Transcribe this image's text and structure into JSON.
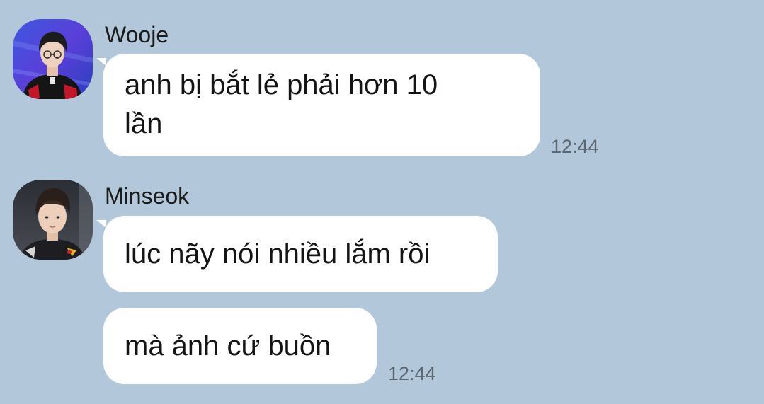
{
  "background_color": "#b2c7da",
  "messages": [
    {
      "sender": "Wooje",
      "avatar_icon": "user-avatar-wooje",
      "bubbles": [
        "anh bị bắt lẻ phải hơn 10\nlần"
      ],
      "time": "12:44"
    },
    {
      "sender": "Minseok",
      "avatar_icon": "user-avatar-minseok",
      "bubbles": [
        "lúc nãy nói nhiều lắm rồi",
        "mà ảnh cứ buồn"
      ],
      "time": "12:44"
    }
  ]
}
